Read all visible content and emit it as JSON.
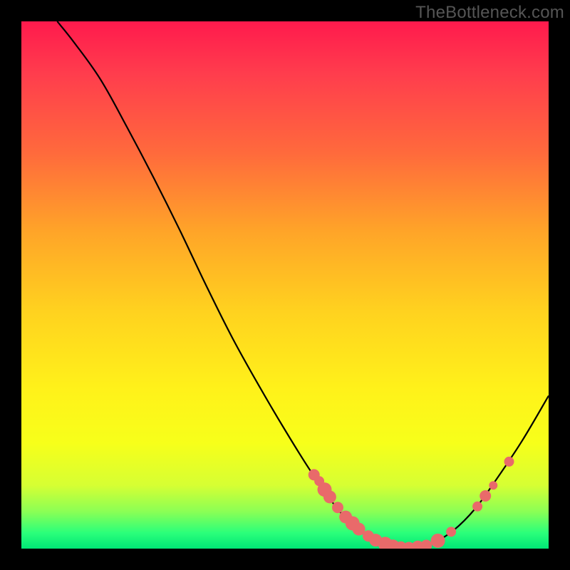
{
  "watermark": "TheBottleneck.com",
  "colors": {
    "marker": "#e96a6a",
    "curve": "#000000"
  },
  "chart_data": {
    "type": "line",
    "title": "",
    "xlabel": "",
    "ylabel": "",
    "xlim": [
      0,
      1
    ],
    "ylim": [
      0,
      1
    ],
    "curve": [
      {
        "x": 0.068,
        "y": 1.0
      },
      {
        "x": 0.1,
        "y": 0.96
      },
      {
        "x": 0.15,
        "y": 0.89
      },
      {
        "x": 0.2,
        "y": 0.8
      },
      {
        "x": 0.25,
        "y": 0.705
      },
      {
        "x": 0.3,
        "y": 0.605
      },
      {
        "x": 0.35,
        "y": 0.5
      },
      {
        "x": 0.4,
        "y": 0.4
      },
      {
        "x": 0.45,
        "y": 0.31
      },
      {
        "x": 0.5,
        "y": 0.225
      },
      {
        "x": 0.55,
        "y": 0.145
      },
      {
        "x": 0.6,
        "y": 0.075
      },
      {
        "x": 0.64,
        "y": 0.035
      },
      {
        "x": 0.68,
        "y": 0.012
      },
      {
        "x": 0.72,
        "y": 0.003
      },
      {
        "x": 0.75,
        "y": 0.002
      },
      {
        "x": 0.78,
        "y": 0.01
      },
      {
        "x": 0.82,
        "y": 0.035
      },
      {
        "x": 0.86,
        "y": 0.075
      },
      {
        "x": 0.9,
        "y": 0.13
      },
      {
        "x": 0.95,
        "y": 0.205
      },
      {
        "x": 1.0,
        "y": 0.29
      }
    ],
    "markers": [
      {
        "x": 0.555,
        "y": 0.14,
        "r": 8
      },
      {
        "x": 0.565,
        "y": 0.128,
        "r": 7
      },
      {
        "x": 0.575,
        "y": 0.112,
        "r": 10
      },
      {
        "x": 0.585,
        "y": 0.098,
        "r": 9
      },
      {
        "x": 0.6,
        "y": 0.078,
        "r": 8
      },
      {
        "x": 0.615,
        "y": 0.06,
        "r": 9
      },
      {
        "x": 0.628,
        "y": 0.048,
        "r": 10
      },
      {
        "x": 0.64,
        "y": 0.037,
        "r": 9
      },
      {
        "x": 0.658,
        "y": 0.024,
        "r": 8
      },
      {
        "x": 0.672,
        "y": 0.016,
        "r": 9
      },
      {
        "x": 0.69,
        "y": 0.009,
        "r": 10
      },
      {
        "x": 0.705,
        "y": 0.005,
        "r": 9
      },
      {
        "x": 0.72,
        "y": 0.003,
        "r": 8
      },
      {
        "x": 0.735,
        "y": 0.002,
        "r": 8
      },
      {
        "x": 0.752,
        "y": 0.003,
        "r": 9
      },
      {
        "x": 0.768,
        "y": 0.006,
        "r": 8
      },
      {
        "x": 0.79,
        "y": 0.015,
        "r": 10
      },
      {
        "x": 0.815,
        "y": 0.032,
        "r": 7
      },
      {
        "x": 0.865,
        "y": 0.08,
        "r": 7
      },
      {
        "x": 0.88,
        "y": 0.1,
        "r": 8
      },
      {
        "x": 0.895,
        "y": 0.12,
        "r": 6
      },
      {
        "x": 0.925,
        "y": 0.165,
        "r": 7
      }
    ]
  }
}
